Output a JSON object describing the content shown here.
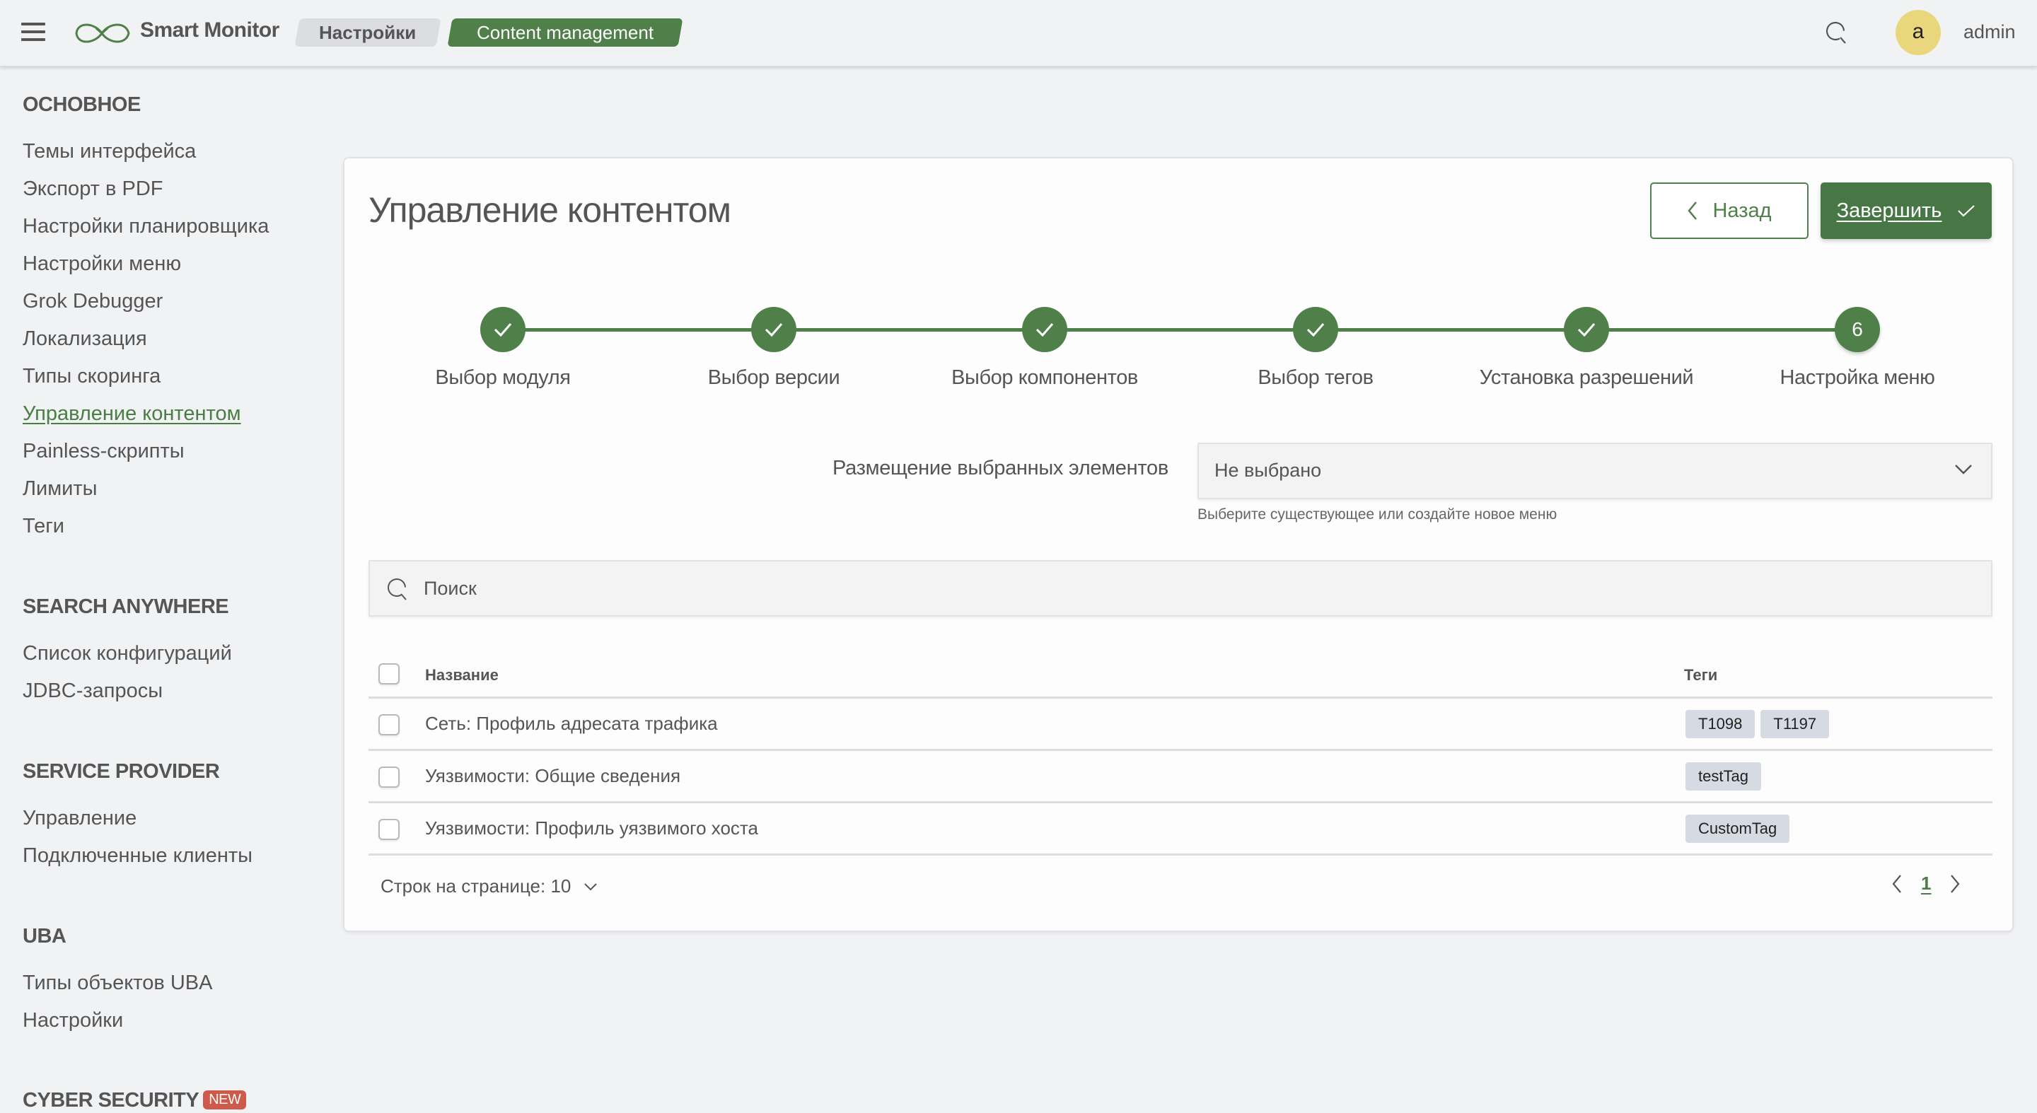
{
  "header": {
    "app_name": "Smart Monitor",
    "breadcrumbs": [
      {
        "label": "Настройки"
      },
      {
        "label": "Content management"
      }
    ],
    "user": {
      "avatar_letter": "a",
      "name": "admin"
    },
    "icons": {
      "menu": "hamburger-icon",
      "logo": "infinity-logo-icon",
      "search": "search-icon"
    }
  },
  "sidebar": {
    "sections": [
      {
        "title": "ОСНОВНОЕ",
        "items": [
          {
            "label": "Темы интерфейса"
          },
          {
            "label": "Экспорт в PDF"
          },
          {
            "label": "Настройки планировщика"
          },
          {
            "label": "Настройки меню"
          },
          {
            "label": "Grok Debugger"
          },
          {
            "label": "Локализация"
          },
          {
            "label": "Типы скоринга"
          },
          {
            "label": "Управление контентом",
            "active": true
          },
          {
            "label": "Painless-скрипты"
          },
          {
            "label": "Лимиты"
          },
          {
            "label": "Теги"
          }
        ]
      },
      {
        "title": "SEARCH ANYWHERE",
        "items": [
          {
            "label": "Список конфигураций"
          },
          {
            "label": "JDBC-запросы"
          }
        ]
      },
      {
        "title": "SERVICE PROVIDER",
        "items": [
          {
            "label": "Управление"
          },
          {
            "label": "Подключенные клиенты"
          }
        ]
      },
      {
        "title": "UBA",
        "items": [
          {
            "label": "Типы объектов UBA"
          },
          {
            "label": "Настройки"
          }
        ]
      },
      {
        "title": "CYBER SECURITY",
        "badge": "NEW",
        "items": []
      }
    ]
  },
  "main": {
    "title": "Управление контентом",
    "back_label": "Назад",
    "finish_label": "Завершить",
    "stepper": {
      "current_step": 6,
      "steps": [
        {
          "label": "Выбор модуля",
          "status": "done"
        },
        {
          "label": "Выбор версии",
          "status": "done"
        },
        {
          "label": "Выбор компонентов",
          "status": "done"
        },
        {
          "label": "Выбор тегов",
          "status": "done"
        },
        {
          "label": "Установка разрешений",
          "status": "done"
        },
        {
          "label": "Настройка меню",
          "status": "current",
          "number": "6"
        }
      ]
    },
    "placement": {
      "label": "Размещение выбранных элементов",
      "value": "Не выбрано",
      "hint": "Выберите существующее или создайте новое меню"
    },
    "search": {
      "placeholder": "Поиск",
      "value": ""
    },
    "table": {
      "columns": {
        "name": "Название",
        "tags": "Теги"
      },
      "rows": [
        {
          "name": "Сеть: Профиль адресата трафика",
          "tags": [
            "T1098",
            "T1197"
          ],
          "checked": false
        },
        {
          "name": "Уязвимости: Общие сведения",
          "tags": [
            "testTag"
          ],
          "checked": false
        },
        {
          "name": "Уязвимости: Профиль уязвимого хоста",
          "tags": [
            "CustomTag"
          ],
          "checked": false
        }
      ]
    },
    "footer": {
      "rows_per_page_label": "Строк на странице: 10",
      "current_page": "1"
    }
  },
  "colors": {
    "accent": "#4f8049",
    "accent_dark": "#477744",
    "background": "#f1f2f4",
    "card": "#fdfdfe",
    "text": "#555555",
    "avatar": "#ead67d",
    "tag_bg": "#d5dae3",
    "new_badge": "#cd5a4a"
  }
}
